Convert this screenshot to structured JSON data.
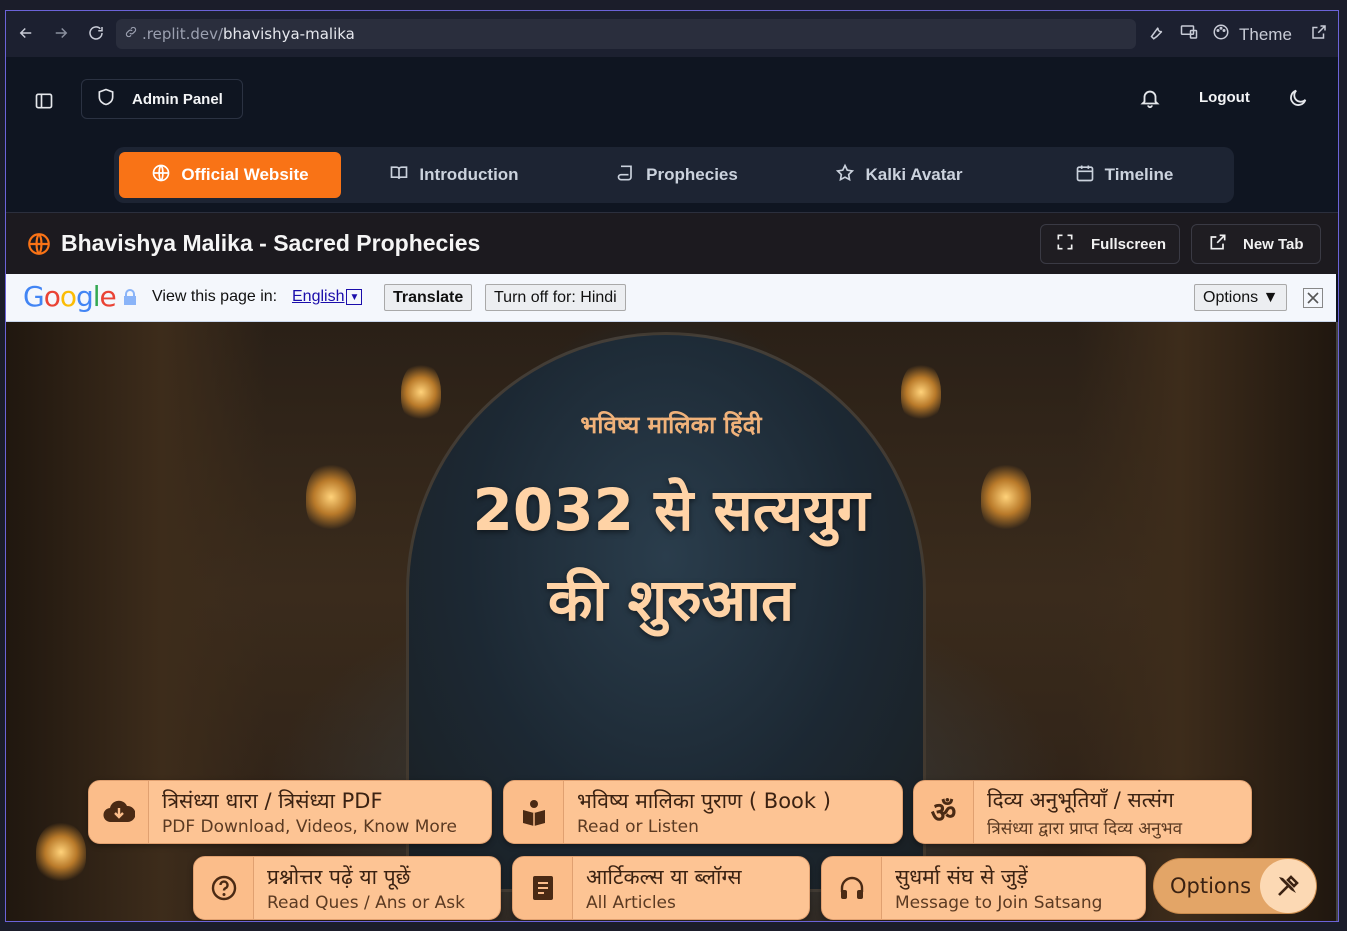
{
  "browser": {
    "url_prefix": ".replit.dev/",
    "url_path": "bhavishya-malika",
    "theme_label": "Theme"
  },
  "header": {
    "admin_label": "Admin Panel",
    "logout_label": "Logout"
  },
  "tabs": [
    {
      "label": "Official Website",
      "icon": "globe-icon",
      "active": true
    },
    {
      "label": "Introduction",
      "icon": "book-open-icon",
      "active": false
    },
    {
      "label": "Prophecies",
      "icon": "scroll-icon",
      "active": false
    },
    {
      "label": "Kalki Avatar",
      "icon": "star-icon",
      "active": false
    },
    {
      "label": "Timeline",
      "icon": "calendar-icon",
      "active": false
    }
  ],
  "section": {
    "title": "Bhavishya Malika - Sacred Prophecies",
    "fullscreen_label": "Fullscreen",
    "newtab_label": "New Tab"
  },
  "translate_bar": {
    "logo": "Google",
    "prompt": "View this page in:",
    "language": "English",
    "translate_label": "Translate",
    "turnoff_label": "Turn off for: Hindi",
    "options_label": "Options ▼"
  },
  "hero": {
    "subtitle": "भविष्य मालिका हिंदी",
    "title_line1": "2032 से सत्ययुग",
    "title_line2": "की शुरुआत"
  },
  "cards": [
    {
      "title": "त्रिसंध्या धारा / त्रिसंध्या PDF",
      "subtitle": "PDF Download, Videos, Know More",
      "icon": "cloud-download-icon"
    },
    {
      "title": "भविष्य मालिका पुराण ( Book )",
      "subtitle": "Read or Listen",
      "icon": "book-reader-icon"
    },
    {
      "title": "दिव्य अनुभूतियाँ / सत्संग",
      "subtitle": "त्रिसंध्या द्वारा प्राप्त दिव्य अनुभव",
      "icon": "om-icon"
    },
    {
      "title": "प्रश्नोत्तर पढ़ें या पूछें",
      "subtitle": "Read Ques / Ans or Ask",
      "icon": "question-icon"
    },
    {
      "title": "आर्टिकल्स या ब्लॉग्स",
      "subtitle": "All Articles",
      "icon": "article-book-icon"
    },
    {
      "title": "सुधर्मा संघ से जुड़ें",
      "subtitle": "Message to Join Satsang",
      "icon": "headphones-icon"
    }
  ],
  "options_button": {
    "label": "Options",
    "icon": "tools-icon"
  },
  "colors": {
    "accent": "#f97316",
    "card": "#fdc494",
    "hero_text": "#ffd3a6"
  }
}
